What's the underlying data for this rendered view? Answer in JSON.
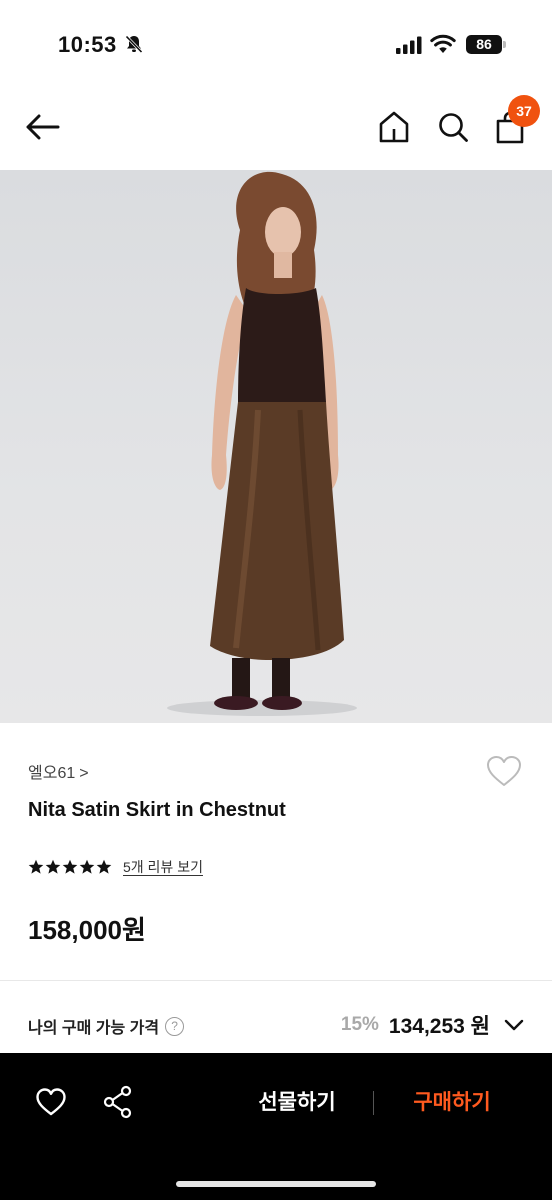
{
  "status_bar": {
    "time": "10:53",
    "battery": "86"
  },
  "header": {
    "cart_count": "37"
  },
  "product": {
    "brand": "엘오61",
    "brand_chevron": ">",
    "title": "Nita Satin Skirt in Chestnut",
    "rating_stars": 5,
    "review_link": "5개 리뷰 보기",
    "price": "158,000원"
  },
  "my_price": {
    "label": "나의 구매 가능 가격",
    "help": "?",
    "discount_rate": "15%",
    "discount_price": "134,253 원"
  },
  "bottom_bar": {
    "gift_label": "선물하기",
    "buy_label": "구매하기"
  },
  "colors": {
    "accent": "#f0520f",
    "buy_text": "#ff5a1f",
    "bottom_bar": "#000000"
  },
  "icons": [
    "bell-off-icon",
    "signal-icon",
    "wifi-icon",
    "back-icon",
    "home-icon",
    "search-icon",
    "cart-icon",
    "heart-icon",
    "star-icon",
    "help-icon",
    "chevron-down-icon",
    "share-icon"
  ]
}
